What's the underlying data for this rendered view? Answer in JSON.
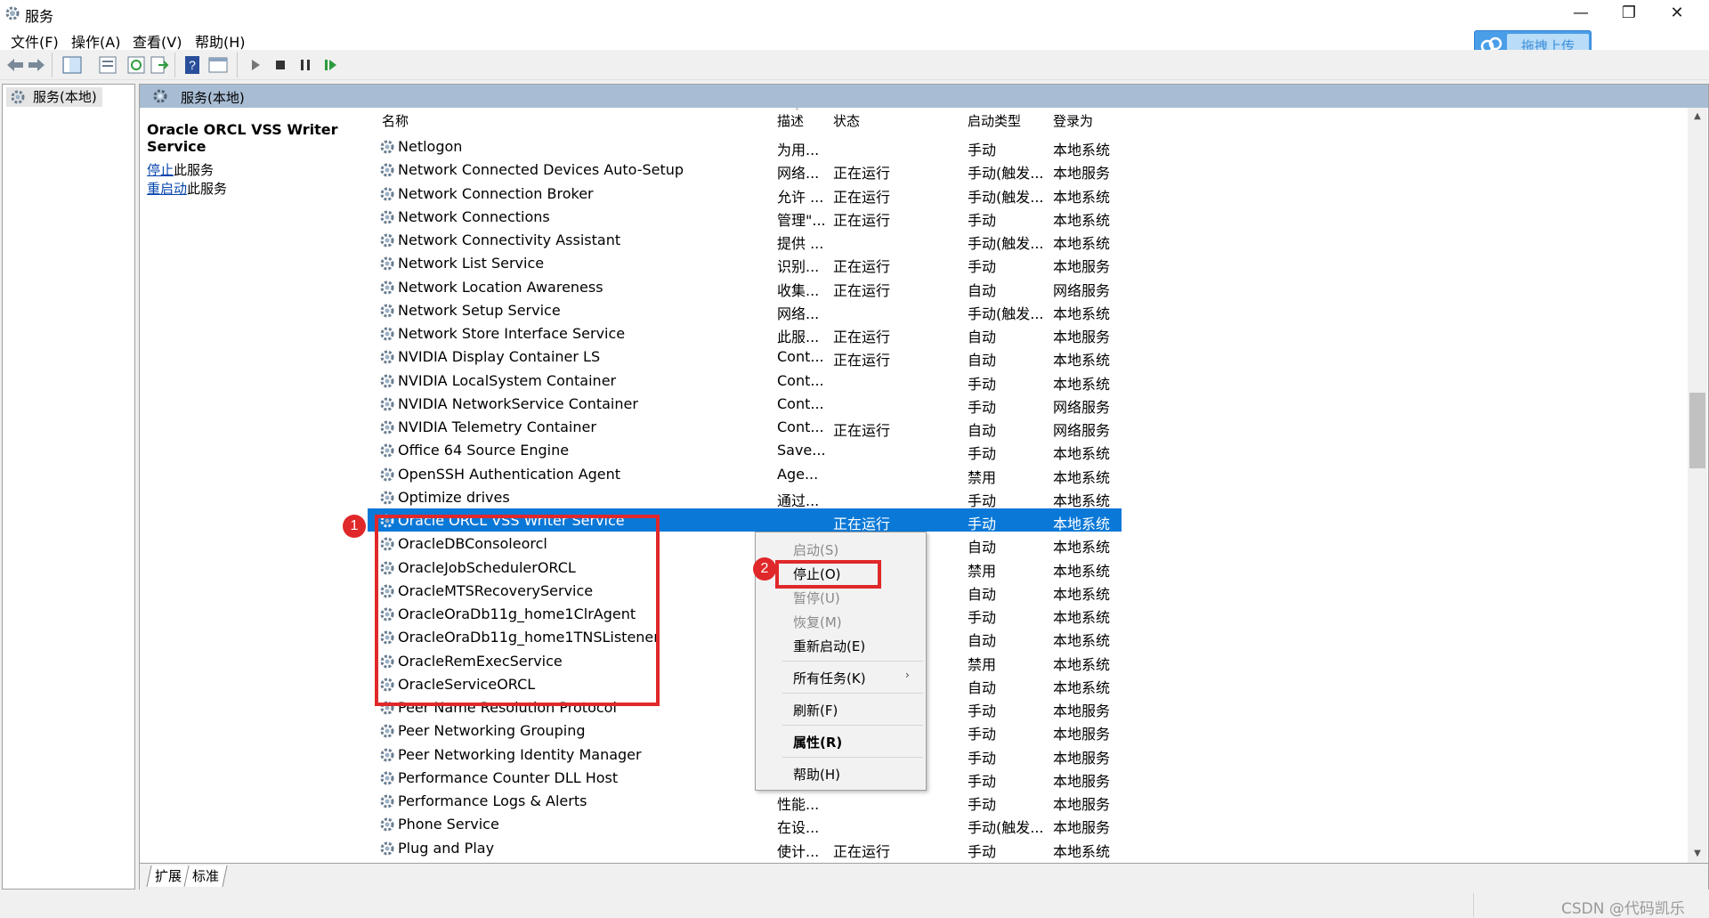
{
  "window": {
    "title": "服务",
    "minimize_glyph": "—",
    "maximize_glyph": "❐",
    "close_glyph": "✕"
  },
  "menu": [
    "文件(F)",
    "操作(A)",
    "查看(V)",
    "帮助(H)"
  ],
  "upload_badge": {
    "label": "拖拽上传",
    "icon": "cloud-icon"
  },
  "toolbar_icons": [
    "back-arrow-icon",
    "forward-arrow-icon",
    "console-tree-icon",
    "export-list-icon",
    "refresh-icon",
    "export-icon",
    "help-icon",
    "properties-icon",
    "play-icon",
    "stop-icon",
    "pause-icon",
    "restart-icon"
  ],
  "tree": {
    "node_label": "服务(本地)"
  },
  "panel": {
    "header": "服务(本地)",
    "selected_service": "Oracle ORCL VSS Writer Service",
    "action_stop_link": "停止",
    "action_stop_suffix": "此服务",
    "action_restart_link": "重启动",
    "action_restart_suffix": "此服务"
  },
  "columns": {
    "name": "名称",
    "desc": "描述",
    "status": "状态",
    "startup": "启动类型",
    "logon": "登录为",
    "sort_glyph": "˄"
  },
  "rows": [
    {
      "name": "Netlogon",
      "desc": "为用...",
      "status": "",
      "startup": "手动",
      "logon": "本地系统"
    },
    {
      "name": "Network Connected Devices Auto-Setup",
      "desc": "网络...",
      "status": "正在运行",
      "startup": "手动(触发...",
      "logon": "本地服务"
    },
    {
      "name": "Network Connection Broker",
      "desc": "允许 ...",
      "status": "正在运行",
      "startup": "手动(触发...",
      "logon": "本地系统"
    },
    {
      "name": "Network Connections",
      "desc": "管理\"...",
      "status": "正在运行",
      "startup": "手动",
      "logon": "本地系统"
    },
    {
      "name": "Network Connectivity Assistant",
      "desc": "提供 ...",
      "status": "",
      "startup": "手动(触发...",
      "logon": "本地系统"
    },
    {
      "name": "Network List Service",
      "desc": "识别...",
      "status": "正在运行",
      "startup": "手动",
      "logon": "本地服务"
    },
    {
      "name": "Network Location Awareness",
      "desc": "收集...",
      "status": "正在运行",
      "startup": "自动",
      "logon": "网络服务"
    },
    {
      "name": "Network Setup Service",
      "desc": "网络...",
      "status": "",
      "startup": "手动(触发...",
      "logon": "本地系统"
    },
    {
      "name": "Network Store Interface Service",
      "desc": "此服...",
      "status": "正在运行",
      "startup": "自动",
      "logon": "本地服务"
    },
    {
      "name": "NVIDIA Display Container LS",
      "desc": "Cont...",
      "status": "正在运行",
      "startup": "自动",
      "logon": "本地系统"
    },
    {
      "name": "NVIDIA LocalSystem Container",
      "desc": "Cont...",
      "status": "",
      "startup": "手动",
      "logon": "本地系统"
    },
    {
      "name": "NVIDIA NetworkService Container",
      "desc": "Cont...",
      "status": "",
      "startup": "手动",
      "logon": "网络服务"
    },
    {
      "name": "NVIDIA Telemetry Container",
      "desc": "Cont...",
      "status": "正在运行",
      "startup": "自动",
      "logon": "网络服务"
    },
    {
      "name": "Office 64 Source Engine",
      "desc": "Save...",
      "status": "",
      "startup": "手动",
      "logon": "本地系统"
    },
    {
      "name": "OpenSSH Authentication Agent",
      "desc": "Age...",
      "status": "",
      "startup": "禁用",
      "logon": "本地系统"
    },
    {
      "name": "Optimize drives",
      "desc": "通过...",
      "status": "",
      "startup": "手动",
      "logon": "本地系统"
    },
    {
      "name": "Oracle ORCL VSS Writer Service",
      "desc": "",
      "status": "正在运行",
      "startup": "手动",
      "logon": "本地系统"
    },
    {
      "name": "OracleDBConsoleorcl",
      "desc": "",
      "status": "",
      "startup": "自动",
      "logon": "本地系统"
    },
    {
      "name": "OracleJobSchedulerORCL",
      "desc": "",
      "status": "",
      "startup": "禁用",
      "logon": "本地系统"
    },
    {
      "name": "OracleMTSRecoveryService",
      "desc": "",
      "status": "",
      "startup": "自动",
      "logon": "本地系统"
    },
    {
      "name": "OracleOraDb11g_home1ClrAgent",
      "desc": "",
      "status": "",
      "startup": "手动",
      "logon": "本地系统"
    },
    {
      "name": "OracleOraDb11g_home1TNSListener",
      "desc": "",
      "status": "",
      "startup": "自动",
      "logon": "本地系统"
    },
    {
      "name": "OracleRemExecService",
      "desc": "",
      "status": "",
      "startup": "禁用",
      "logon": "本地系统"
    },
    {
      "name": "OracleServiceORCL",
      "desc": "",
      "status": "",
      "startup": "自动",
      "logon": "本地系统"
    },
    {
      "name": "Peer Name Resolution Protocol",
      "desc": "",
      "status": "",
      "startup": "手动",
      "logon": "本地服务"
    },
    {
      "name": "Peer Networking Grouping",
      "desc": "",
      "status": "",
      "startup": "手动",
      "logon": "本地服务"
    },
    {
      "name": "Peer Networking Identity Manager",
      "desc": "",
      "status": "",
      "startup": "手动",
      "logon": "本地服务"
    },
    {
      "name": "Performance Counter DLL Host",
      "desc": "",
      "status": "",
      "startup": "手动",
      "logon": "本地服务"
    },
    {
      "name": "Performance Logs & Alerts",
      "desc": "性能...",
      "status": "",
      "startup": "手动",
      "logon": "本地服务"
    },
    {
      "name": "Phone Service",
      "desc": "在设...",
      "status": "",
      "startup": "手动(触发...",
      "logon": "本地服务"
    },
    {
      "name": "Plug and Play",
      "desc": "使计...",
      "status": "正在运行",
      "startup": "手动",
      "logon": "本地系统"
    }
  ],
  "selected_row_index": 16,
  "context_menu": {
    "start": "启动(S)",
    "stop": "停止(O)",
    "pause": "暂停(U)",
    "resume": "恢复(M)",
    "restart": "重新启动(E)",
    "all_tasks": "所有任务(K)",
    "all_tasks_arrow": "›",
    "refresh": "刷新(F)",
    "properties": "属性(R)",
    "help": "帮助(H)"
  },
  "tabs": [
    "扩展",
    "标准"
  ],
  "annotations": {
    "badge1": "1",
    "badge2": "2",
    "color": "#e0282a"
  },
  "watermark": "CSDN @代码凯乐",
  "colors": {
    "selection": "#0a78d7",
    "header_band": "#a8bdd4",
    "upload_blue": "#4a9ee8"
  }
}
